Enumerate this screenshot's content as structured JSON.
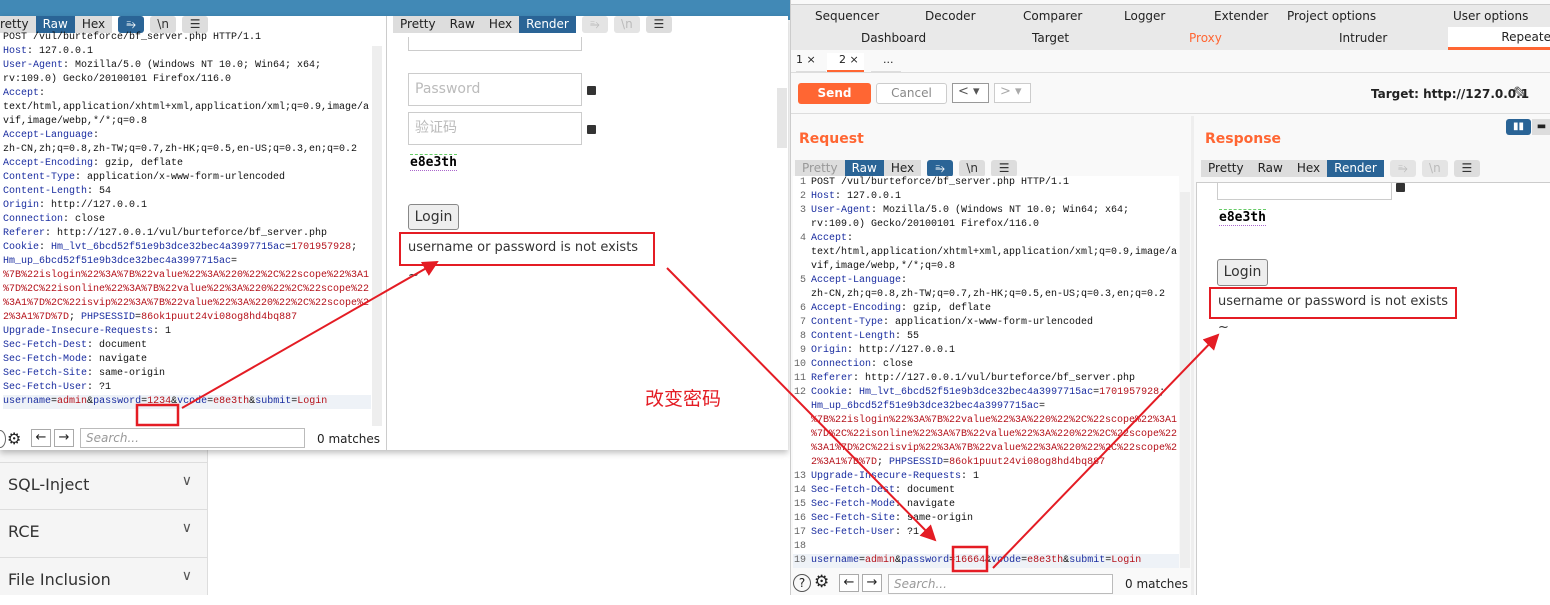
{
  "colors": {
    "accent": "#ff6633",
    "selected_blue": "#2a6496",
    "annotation_red": "#e41c24"
  },
  "background_page": {
    "sidebar": [
      {
        "label": "SQL-Inject",
        "icon": "chevron-down-icon"
      },
      {
        "label": "RCE",
        "icon": "chevron-down-icon"
      },
      {
        "label": "File Inclusion",
        "icon": "chevron-down-icon"
      }
    ]
  },
  "left_window": {
    "request_tabs": [
      "retty",
      "Raw",
      "Hex"
    ],
    "icons": {
      "wrap": "⥱",
      "newline": "\\n",
      "menu": "☰"
    },
    "lines": [
      [
        [
          "p",
          "POST /vul/burteforce/bf_server.php HTTP/1.1"
        ]
      ],
      [
        [
          "n",
          "Host"
        ],
        [
          "p",
          ": 127.0.0.1"
        ]
      ],
      [
        [
          "n",
          "User-Agent"
        ],
        [
          "p",
          ": Mozilla/5.0 (Windows NT 10.0; Win64; x64;"
        ]
      ],
      [
        [
          "p",
          "rv:109.0) Gecko/20100101 Firefox/116.0"
        ]
      ],
      [
        [
          "n",
          "Accept"
        ],
        [
          "p",
          ":"
        ]
      ],
      [
        [
          "p",
          "text/html,application/xhtml+xml,application/xml;q=0.9,image/a"
        ]
      ],
      [
        [
          "p",
          "vif,image/webp,*/*;q=0.8"
        ]
      ],
      [
        [
          "n",
          "Accept-Language"
        ],
        [
          "p",
          ":"
        ]
      ],
      [
        [
          "p",
          "zh-CN,zh;q=0.8,zh-TW;q=0.7,zh-HK;q=0.5,en-US;q=0.3,en;q=0.2"
        ]
      ],
      [
        [
          "n",
          "Accept-Encoding"
        ],
        [
          "p",
          ": gzip, deflate"
        ]
      ],
      [
        [
          "n",
          "Content-Type"
        ],
        [
          "p",
          ": application/x-www-form-urlencoded"
        ]
      ],
      [
        [
          "n",
          "Content-Length"
        ],
        [
          "p",
          ": 54"
        ]
      ],
      [
        [
          "n",
          "Origin"
        ],
        [
          "p",
          ": http://127.0.0.1"
        ]
      ],
      [
        [
          "n",
          "Connection"
        ],
        [
          "p",
          ": close"
        ]
      ],
      [
        [
          "n",
          "Referer"
        ],
        [
          "p",
          ": http://127.0.0.1/vul/burteforce/bf_server.php"
        ]
      ],
      [
        [
          "n",
          "Cookie"
        ],
        [
          "p",
          ": "
        ],
        [
          "n",
          "Hm_lvt_6bcd52f51e9b3dce32bec4a3997715ac"
        ],
        [
          "p",
          "="
        ],
        [
          "v",
          "1701957928"
        ],
        [
          "p",
          ";"
        ]
      ],
      [
        [
          "n",
          "Hm_up_6bcd52f51e9b3dce32bec4a3997715ac"
        ],
        [
          "p",
          "="
        ]
      ],
      [
        [
          "v",
          "%7B%22islogin%22%3A%7B%22value%22%3A%220%22%2C%22scope%22%3A1"
        ]
      ],
      [
        [
          "v",
          "%7D%2C%22isonline%22%3A%7B%22value%22%3A%220%22%2C%22scope%22"
        ]
      ],
      [
        [
          "v",
          "%3A1%7D%2C%22isvip%22%3A%7B%22value%22%3A%220%22%2C%22scope%2"
        ]
      ],
      [
        [
          "v",
          "2%3A1%7D%7D"
        ],
        [
          "p",
          "; "
        ],
        [
          "n",
          "PHPSESSID"
        ],
        [
          "p",
          "="
        ],
        [
          "v",
          "86ok1puut24vi08og8hd4bq887"
        ]
      ],
      [
        [
          "n",
          "Upgrade-Insecure-Requests"
        ],
        [
          "p",
          ": 1"
        ]
      ],
      [
        [
          "n",
          "Sec-Fetch-Dest"
        ],
        [
          "p",
          ": document"
        ]
      ],
      [
        [
          "n",
          "Sec-Fetch-Mode"
        ],
        [
          "p",
          ": navigate"
        ]
      ],
      [
        [
          "n",
          "Sec-Fetch-Site"
        ],
        [
          "p",
          ": same-origin"
        ]
      ],
      [
        [
          "n",
          "Sec-Fetch-User"
        ],
        [
          "p",
          ": ?1"
        ]
      ],
      [
        [
          "p",
          ""
        ]
      ],
      [
        [
          "n",
          "username"
        ],
        [
          "p",
          "="
        ],
        [
          "v",
          "admin"
        ],
        [
          "p",
          "&"
        ],
        [
          "n",
          "password"
        ],
        [
          "p",
          "="
        ],
        [
          "v",
          "1234"
        ],
        [
          "p",
          "&"
        ],
        [
          "n",
          "vcode"
        ],
        [
          "p",
          "="
        ],
        [
          "v",
          "e8e3th"
        ],
        [
          "p",
          "&"
        ],
        [
          "n",
          "submit"
        ],
        [
          "p",
          "="
        ],
        [
          "v",
          "Login"
        ]
      ]
    ],
    "search_placeholder": "Search...",
    "matches": "0 matches",
    "response_tabs": [
      "Pretty",
      "Raw",
      "Hex",
      "Render"
    ],
    "render": {
      "password_placeholder": "Password",
      "vcode_placeholder": "验证码",
      "captcha": "e8e3th",
      "login_button": "Login",
      "message": "username or password is not exists ~"
    }
  },
  "annotation": "改变密码",
  "burp": {
    "nav_row1": [
      "Sequencer",
      "Decoder",
      "Comparer",
      "Logger",
      "Extender",
      "Project options",
      "User options"
    ],
    "nav_row2": [
      "Dashboard",
      "Target",
      "Proxy",
      "Intruder",
      "Repeate"
    ],
    "repeater_tabs": [
      "1 ×",
      "2 ×",
      "..."
    ],
    "send": "Send",
    "cancel": "Cancel",
    "target": "Target: http://127.0.0.1",
    "request_title": "Request",
    "response_title": "Response",
    "request_tabs": [
      "Pretty",
      "Raw",
      "Hex"
    ],
    "response_tabs": [
      "Pretty",
      "Raw",
      "Hex",
      "Render"
    ],
    "lines": [
      {
        "num": "1",
        "segs": [
          [
            "p",
            "POST /vul/burteforce/bf_server.php HTTP/1.1"
          ]
        ]
      },
      {
        "num": "2",
        "segs": [
          [
            "n",
            "Host"
          ],
          [
            "p",
            ": 127.0.0.1"
          ]
        ]
      },
      {
        "num": "3",
        "segs": [
          [
            "n",
            "User-Agent"
          ],
          [
            "p",
            ": Mozilla/5.0 (Windows NT 10.0; Win64; x64;"
          ]
        ]
      },
      {
        "num": "",
        "segs": [
          [
            "p",
            "rv:109.0) Gecko/20100101 Firefox/116.0"
          ]
        ]
      },
      {
        "num": "4",
        "segs": [
          [
            "n",
            "Accept"
          ],
          [
            "p",
            ":"
          ]
        ]
      },
      {
        "num": "",
        "segs": [
          [
            "p",
            "text/html,application/xhtml+xml,application/xml;q=0.9,image/a"
          ]
        ]
      },
      {
        "num": "",
        "segs": [
          [
            "p",
            "vif,image/webp,*/*;q=0.8"
          ]
        ]
      },
      {
        "num": "5",
        "segs": [
          [
            "n",
            "Accept-Language"
          ],
          [
            "p",
            ":"
          ]
        ]
      },
      {
        "num": "",
        "segs": [
          [
            "p",
            "zh-CN,zh;q=0.8,zh-TW;q=0.7,zh-HK;q=0.5,en-US;q=0.3,en;q=0.2"
          ]
        ]
      },
      {
        "num": "6",
        "segs": [
          [
            "n",
            "Accept-Encoding"
          ],
          [
            "p",
            ": gzip, deflate"
          ]
        ]
      },
      {
        "num": "7",
        "segs": [
          [
            "n",
            "Content-Type"
          ],
          [
            "p",
            ": application/x-www-form-urlencoded"
          ]
        ]
      },
      {
        "num": "8",
        "segs": [
          [
            "n",
            "Content-Length"
          ],
          [
            "p",
            ": 55"
          ]
        ]
      },
      {
        "num": "9",
        "segs": [
          [
            "n",
            "Origin"
          ],
          [
            "p",
            ": http://127.0.0.1"
          ]
        ]
      },
      {
        "num": "10",
        "segs": [
          [
            "n",
            "Connection"
          ],
          [
            "p",
            ": close"
          ]
        ]
      },
      {
        "num": "11",
        "segs": [
          [
            "n",
            "Referer"
          ],
          [
            "p",
            ": http://127.0.0.1/vul/burteforce/bf_server.php"
          ]
        ]
      },
      {
        "num": "12",
        "segs": [
          [
            "n",
            "Cookie"
          ],
          [
            "p",
            ": "
          ],
          [
            "n",
            "Hm_lvt_6bcd52f51e9b3dce32bec4a3997715ac"
          ],
          [
            "p",
            "="
          ],
          [
            "v",
            "1701957928"
          ],
          [
            "p",
            ";"
          ]
        ]
      },
      {
        "num": "",
        "segs": [
          [
            "n",
            "Hm_up_6bcd52f51e9b3dce32bec4a3997715ac"
          ],
          [
            "p",
            "="
          ]
        ]
      },
      {
        "num": "",
        "segs": [
          [
            "v",
            "%7B%22islogin%22%3A%7B%22value%22%3A%220%22%2C%22scope%22%3A1"
          ]
        ]
      },
      {
        "num": "",
        "segs": [
          [
            "v",
            "%7D%2C%22isonline%22%3A%7B%22value%22%3A%220%22%2C%22scope%22"
          ]
        ]
      },
      {
        "num": "",
        "segs": [
          [
            "v",
            "%3A1%7D%2C%22isvip%22%3A%7B%22value%22%3A%220%22%2C%22scope%2"
          ]
        ]
      },
      {
        "num": "",
        "segs": [
          [
            "v",
            "2%3A1%7D%7D"
          ],
          [
            "p",
            "; "
          ],
          [
            "n",
            "PHPSESSID"
          ],
          [
            "p",
            "="
          ],
          [
            "v",
            "86ok1puut24vi08og8hd4bq887"
          ]
        ]
      },
      {
        "num": "13",
        "segs": [
          [
            "n",
            "Upgrade-Insecure-Requests"
          ],
          [
            "p",
            ": 1"
          ]
        ]
      },
      {
        "num": "14",
        "segs": [
          [
            "n",
            "Sec-Fetch-Dest"
          ],
          [
            "p",
            ": document"
          ]
        ]
      },
      {
        "num": "15",
        "segs": [
          [
            "n",
            "Sec-Fetch-Mode"
          ],
          [
            "p",
            ": navigate"
          ]
        ]
      },
      {
        "num": "16",
        "segs": [
          [
            "n",
            "Sec-Fetch-Site"
          ],
          [
            "p",
            ": same-origin"
          ]
        ]
      },
      {
        "num": "17",
        "segs": [
          [
            "n",
            "Sec-Fetch-User"
          ],
          [
            "p",
            ": ?1"
          ]
        ]
      },
      {
        "num": "18",
        "segs": [
          [
            "p",
            ""
          ]
        ]
      },
      {
        "num": "19",
        "segs": [
          [
            "n",
            "username"
          ],
          [
            "p",
            "="
          ],
          [
            "v",
            "admin"
          ],
          [
            "p",
            "&"
          ],
          [
            "n",
            "password"
          ],
          [
            "p",
            "="
          ],
          [
            "v",
            "16664"
          ],
          [
            "p",
            "&"
          ],
          [
            "n",
            "vcode"
          ],
          [
            "p",
            "="
          ],
          [
            "v",
            "e8e3th"
          ],
          [
            "p",
            "&"
          ],
          [
            "n",
            "submit"
          ],
          [
            "p",
            "="
          ],
          [
            "v",
            "Login"
          ]
        ]
      }
    ],
    "search_placeholder": "Search...",
    "matches": "0 matches",
    "render": {
      "captcha": "e8e3th",
      "login_button": "Login",
      "message": "username or password is not exists ~"
    }
  }
}
